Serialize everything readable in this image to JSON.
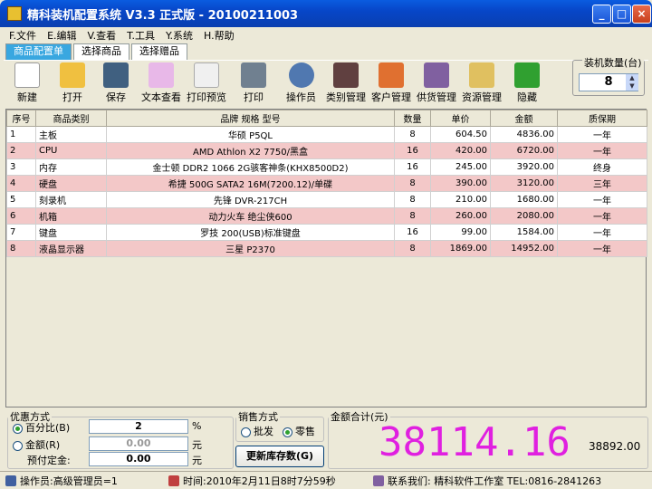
{
  "window": {
    "title": "精科装机配置系统 V3.3 正式版 - 20100211003",
    "min": "_",
    "max": "□",
    "close": "×"
  },
  "menu": [
    "F.文件",
    "E.编辑",
    "V.查看",
    "T.工具",
    "Y.系统",
    "H.帮助"
  ],
  "tabs": [
    "商品配置单",
    "选择商品",
    "选择赠品"
  ],
  "toolbar": {
    "new": "新建",
    "open": "打开",
    "save": "保存",
    "text_view": "文本查看",
    "print_preview": "打印预览",
    "print": "打印",
    "operator": "操作员",
    "category": "类别管理",
    "customer": "客户管理",
    "supplier": "供货管理",
    "resource": "资源管理",
    "hide": "隐藏"
  },
  "quantity": {
    "label": "装机数量(台)",
    "value": "8"
  },
  "table": {
    "headers": [
      "序号",
      "商品类别",
      "品牌 规格 型号",
      "数量",
      "单价",
      "金额",
      "质保期"
    ],
    "rows": [
      [
        "1",
        "主板",
        "华硕 P5QL",
        "8",
        "604.50",
        "4836.00",
        "一年"
      ],
      [
        "2",
        "CPU",
        "AMD Athlon X2 7750/黑盒",
        "16",
        "420.00",
        "6720.00",
        "一年"
      ],
      [
        "3",
        "内存",
        "金士顿 DDR2 1066 2G骇客神条(KHX8500D2)",
        "16",
        "245.00",
        "3920.00",
        "终身"
      ],
      [
        "4",
        "硬盘",
        "希捷 500G SATA2 16M(7200.12)/单碟",
        "8",
        "390.00",
        "3120.00",
        "三年"
      ],
      [
        "5",
        "刻录机",
        "先锋 DVR-217CH",
        "8",
        "210.00",
        "1680.00",
        "一年"
      ],
      [
        "6",
        "机箱",
        "动力火车 绝尘侠600",
        "8",
        "260.00",
        "2080.00",
        "一年"
      ],
      [
        "7",
        "键盘",
        "罗技 200(USB)标准键盘",
        "16",
        "99.00",
        "1584.00",
        "一年"
      ],
      [
        "8",
        "液晶显示器",
        "三星 P2370",
        "8",
        "1869.00",
        "14952.00",
        "一年"
      ]
    ]
  },
  "discount": {
    "legend": "优惠方式",
    "pct_label": "百分比(B)",
    "pct_value": "2",
    "pct_unit": "%",
    "amt_label": "金额(R)",
    "amt_value": "0.00",
    "amt_unit": "元",
    "deposit_label": "预付定金:",
    "deposit_value": "0.00",
    "deposit_unit": "元"
  },
  "sale": {
    "legend": "销售方式",
    "wholesale": "批发",
    "retail": "零售"
  },
  "update_button": "更新库存数(G)",
  "total": {
    "legend": "金额合计(元)",
    "value": "38114.16",
    "original": "38892.00"
  },
  "status": {
    "operator": "操作员:高级管理员=1",
    "time": "时间:2010年2月11日8时7分59秒",
    "contact": "联系我们: 精科软件工作室 TEL:0816-2841263"
  }
}
